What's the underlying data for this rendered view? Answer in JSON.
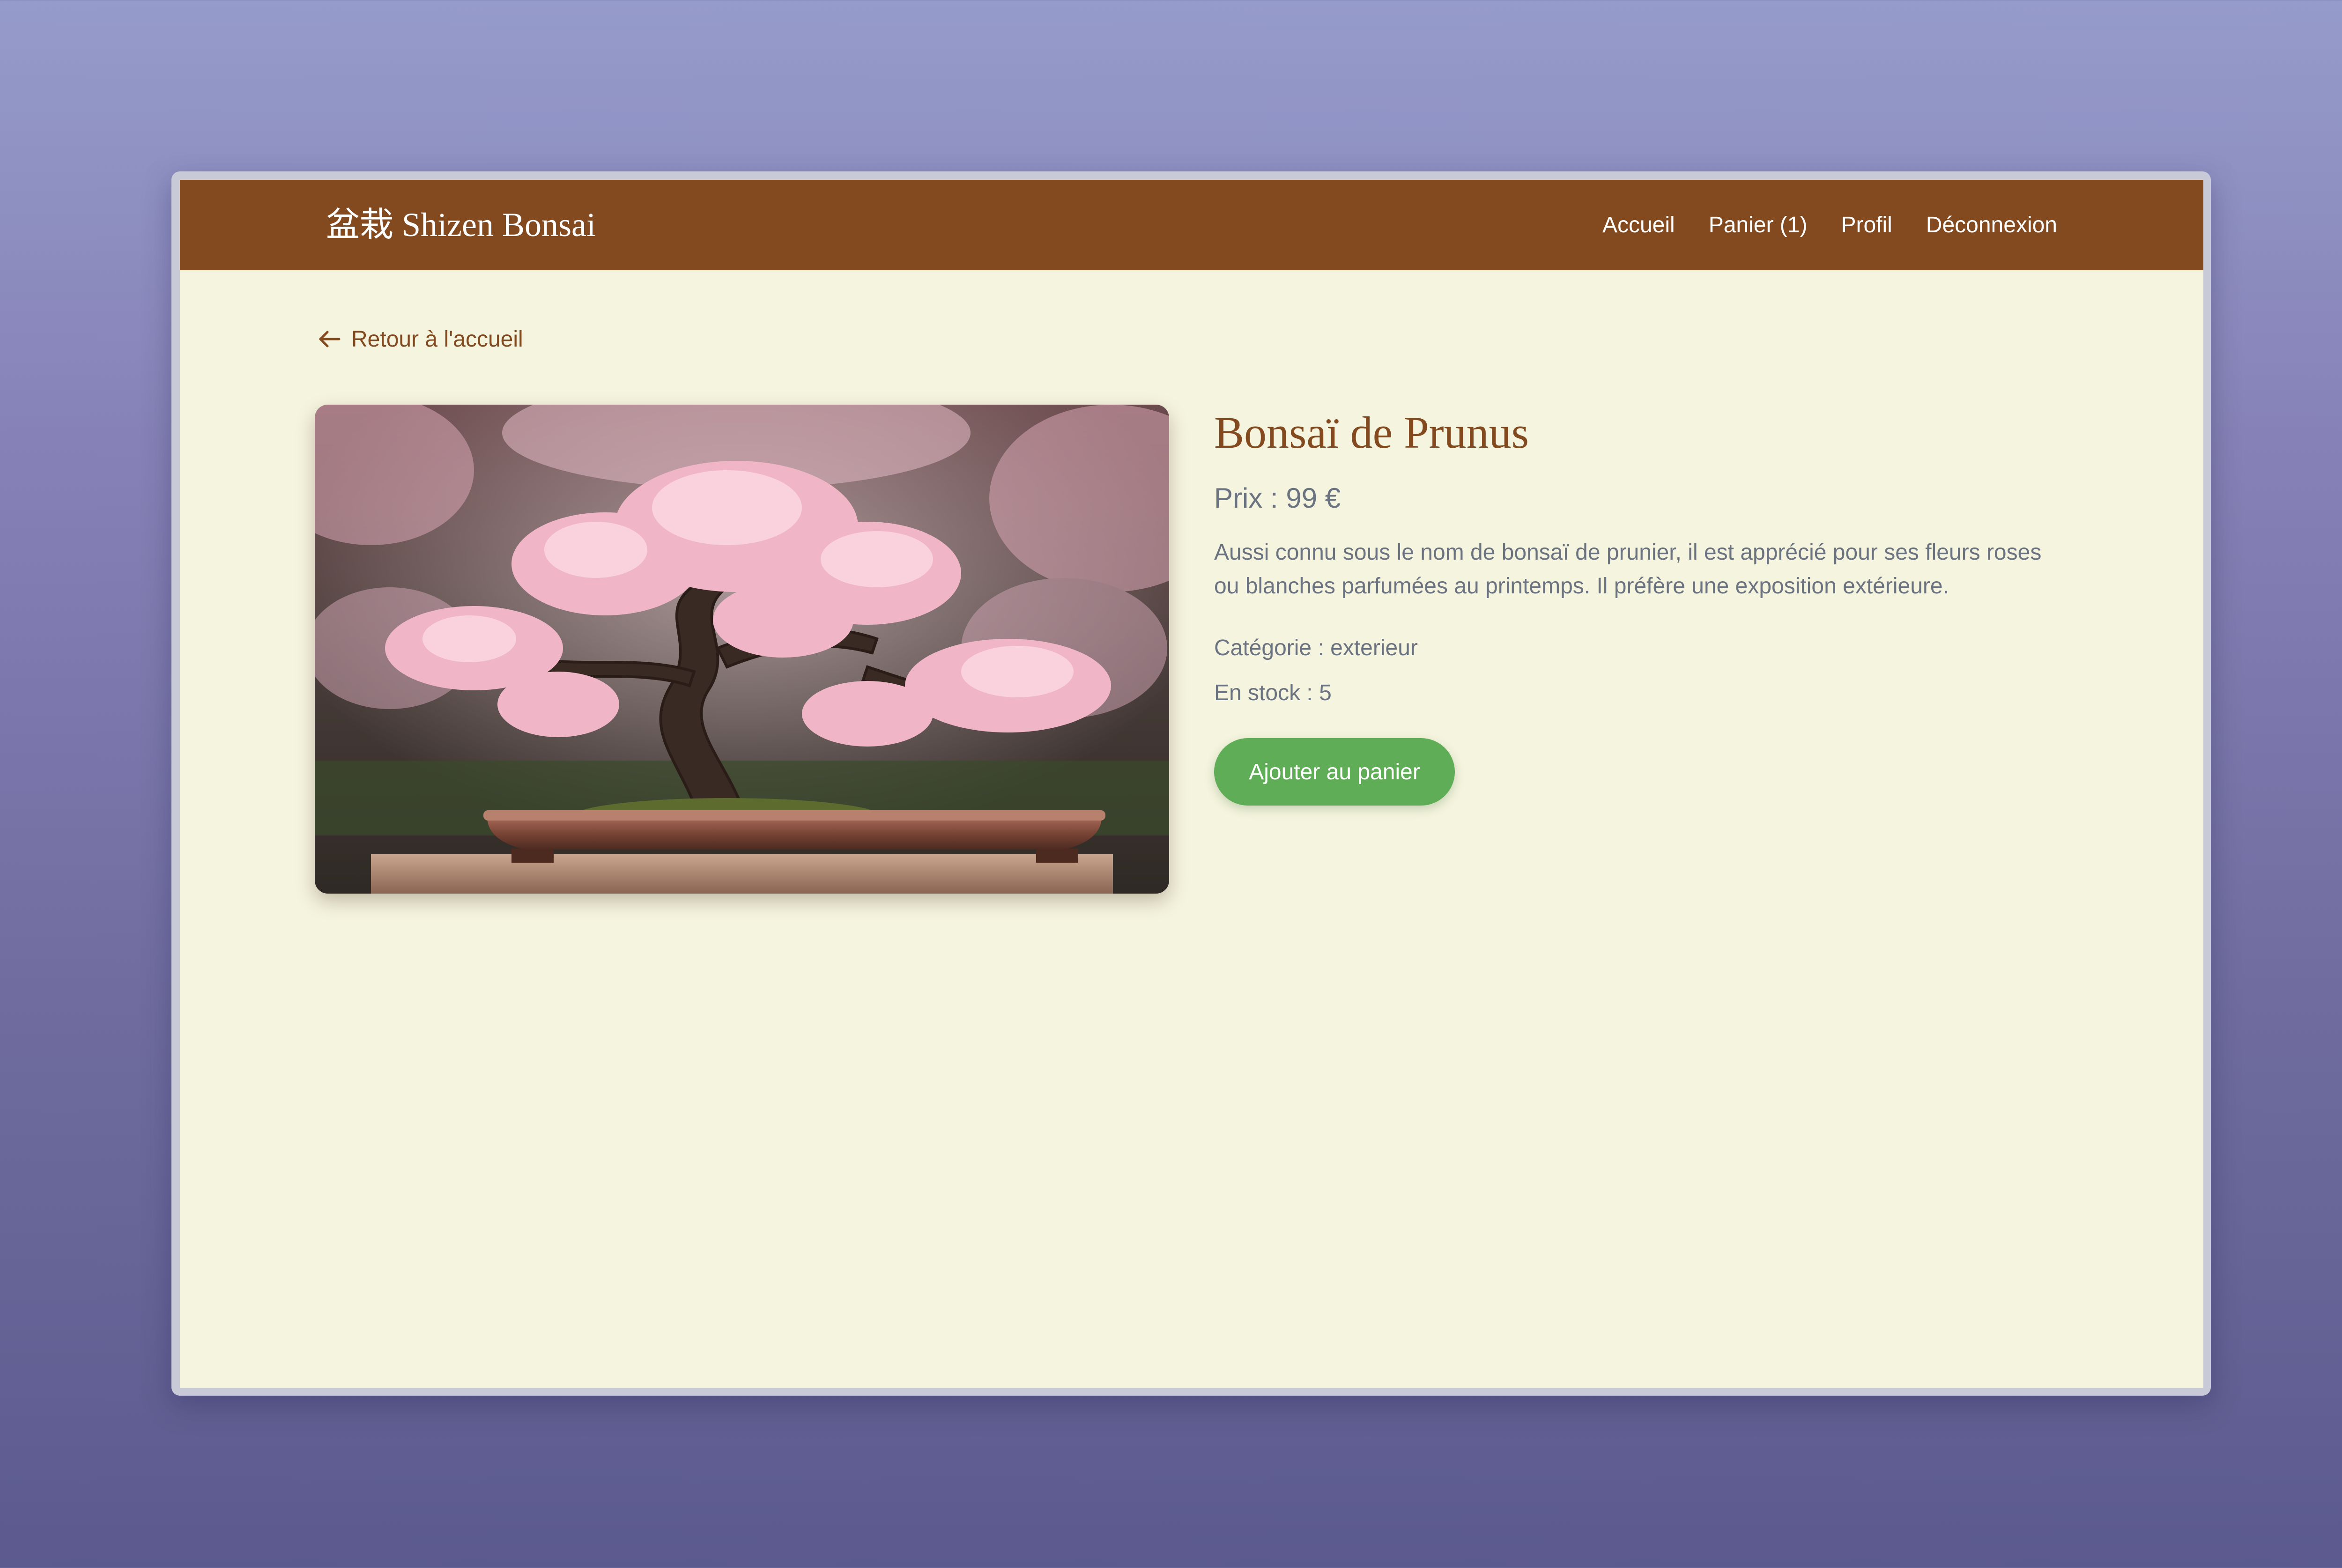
{
  "navbar": {
    "brand": "盆栽 Shizen Bonsai",
    "links": [
      {
        "label": "Accueil"
      },
      {
        "label": "Panier (1)"
      },
      {
        "label": "Profil"
      },
      {
        "label": "Déconnexion"
      }
    ]
  },
  "back_link": {
    "label": "Retour à l'accueil",
    "icon": "arrow-left-icon"
  },
  "product": {
    "image": "cherry-blossom-bonsai-photo",
    "title": "Bonsaï de Prunus",
    "price": "Prix : 99 €",
    "description": "Aussi connu sous le nom de bonsaï de prunier, il est apprécié pour ses fleurs roses ou blanches parfumées au printemps. Il préfère une exposition extérieure.",
    "category": "Catégorie : exterieur",
    "stock": "En stock : 5",
    "add_to_cart_label": "Ajouter au panier"
  },
  "colors": {
    "navbar": "#834a20",
    "page_background": "#f5f4de",
    "accent_text": "#834a20",
    "muted_text": "#6b7280",
    "button": "#5fad56"
  }
}
